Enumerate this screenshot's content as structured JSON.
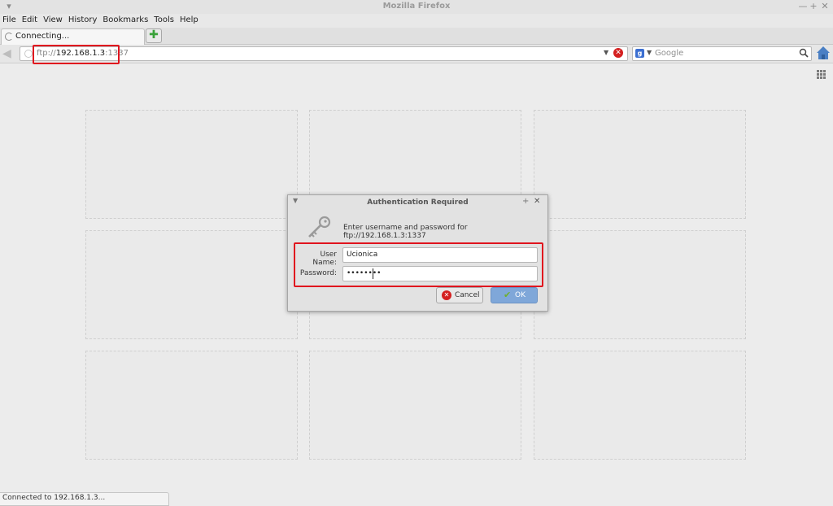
{
  "window": {
    "title": "Mozilla Firefox"
  },
  "menu": [
    "File",
    "Edit",
    "View",
    "History",
    "Bookmarks",
    "Tools",
    "Help"
  ],
  "tab": {
    "label": "Connecting..."
  },
  "navbar": {
    "url_scheme": "ftp://",
    "url_host": "192.168.1.3",
    "url_port": ":1337"
  },
  "search": {
    "placeholder": "Google"
  },
  "dialog": {
    "title": "Authentication Required",
    "message": "Enter username and password for ftp://192.168.1.3:1337",
    "username_label": "User Name:",
    "username_value": "Ucionica",
    "password_label": "Password:",
    "password_value": "••••••••",
    "cancel_label": "Cancel",
    "ok_label": "OK"
  },
  "status": {
    "text": "Connected to 192.168.1.3..."
  },
  "colors": {
    "highlight": "#e0141e",
    "ok_button": "#7fa7d9",
    "stop": "#d42020"
  }
}
